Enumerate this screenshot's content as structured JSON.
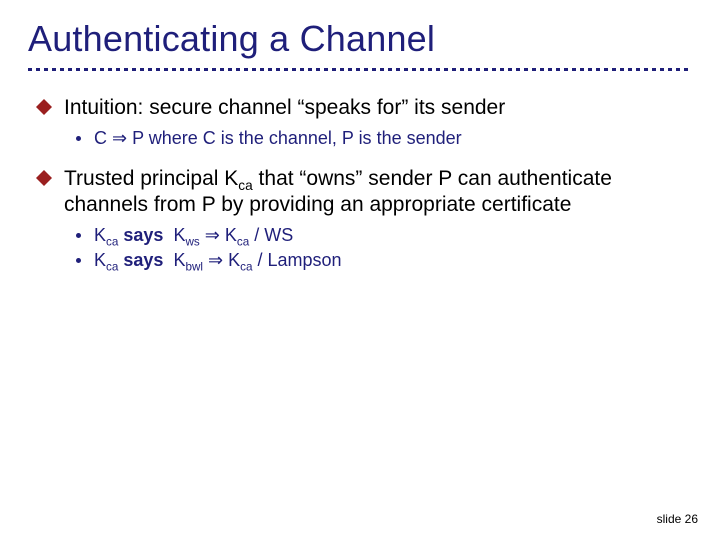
{
  "title": "Authenticating a Channel",
  "bullets": {
    "b1": {
      "text": "Intuition: secure channel “speaks for” its sender",
      "sub": {
        "s1_prefix": "C ",
        "s1_arrow": "⇒",
        "s1_suffix": " P where C is the channel, P is the sender"
      }
    },
    "b2": {
      "line1_prefix": "Trusted principal K",
      "line1_sub": "ca",
      "line1_suffix": " that “owns” sender P can authenticate channels from P by providing an appropriate certificate",
      "sub": {
        "s1": {
          "k1": "K",
          "k1sub": "ca",
          "says": " says ",
          "k2": "K",
          "k2sub": "ws",
          "arrow": " ⇒ ",
          "k3": "K",
          "k3sub": "ca",
          "tail": " / WS"
        },
        "s2": {
          "k1": "K",
          "k1sub": "ca",
          "says": " says ",
          "k2": "K",
          "k2sub": "bwl",
          "arrow": " ⇒ ",
          "k3": "K",
          "k3sub": "ca",
          "tail": " / Lampson"
        }
      }
    }
  },
  "footer": {
    "label": "slide ",
    "number": "26"
  }
}
